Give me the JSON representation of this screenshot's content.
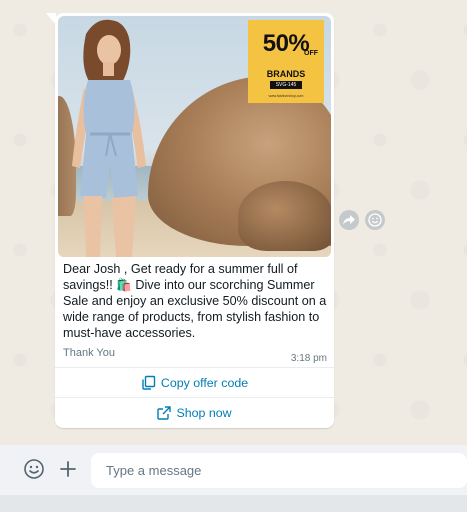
{
  "colors": {
    "chat_background": "#efeae2",
    "bubble": "#ffffff",
    "link": "#027eb5",
    "meta_text": "#667781",
    "promo_yellow": "#f5c342"
  },
  "message": {
    "image": {
      "promo_percent": "50%",
      "promo_off": "OFF",
      "promo_brands": "BRANDS",
      "promo_code": "SVG-145",
      "promo_url": "www.fashionshop.com"
    },
    "body": "Dear Josh , Get ready for a summer full of savings!! 🛍️ Dive into our scorching Summer Sale and enjoy an exclusive 50% discount on a wide range of products, from stylish fashion to must-have accessories.",
    "footer": "Thank You",
    "time": "3:18 pm",
    "buttons": [
      {
        "label": "Copy offer code",
        "icon": "copy-icon"
      },
      {
        "label": "Shop now",
        "icon": "external-link-icon"
      }
    ]
  },
  "side_actions": {
    "forward_icon": "forward-icon",
    "react_icon": "emoji-react-icon"
  },
  "composer": {
    "emoji_icon": "emoji-icon",
    "attach_icon": "plus-icon",
    "placeholder": "Type a message"
  }
}
